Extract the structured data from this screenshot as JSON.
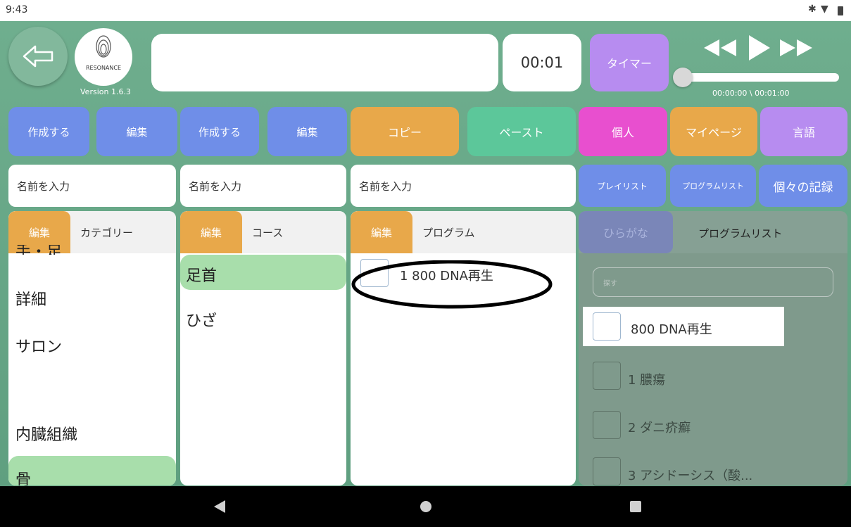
{
  "status": {
    "time": "9:43",
    "icons": [
      "bluetooth-icon",
      "wifi-icon",
      "battery-icon"
    ]
  },
  "header": {
    "logo_text": "RESONANCE",
    "version": "Version 1.6.3",
    "title_value": "",
    "counter": "00:01",
    "timer_label": "タイマー",
    "playback_time": "00:00:00 \\ 00:01:00",
    "progress": 0.0
  },
  "toolbar": {
    "cat_create": "作成する",
    "cat_edit": "編集",
    "course_create": "作成する",
    "course_edit": "編集",
    "copy": "コピー",
    "paste": "ペースト",
    "personal": "個人",
    "mypage": "マイページ",
    "language": "言語"
  },
  "inputs": {
    "category_placeholder": "名前を入力",
    "course_placeholder": "名前を入力",
    "program_placeholder": "名前を入力"
  },
  "right_tabs": {
    "playlist": "プレイリスト",
    "program_list": "プログラムリスト",
    "records": "個々の記録"
  },
  "category_panel": {
    "edit": "編集",
    "title": "カテゴリー",
    "items": [
      "手・足",
      "詳細",
      "サロン",
      "内臓組織",
      "骨"
    ]
  },
  "course_panel": {
    "edit": "編集",
    "title": "コース",
    "items": [
      "足首",
      "ひざ"
    ]
  },
  "program_panel": {
    "edit": "編集",
    "title": "プログラム",
    "items": [
      "1  800 DNA再生"
    ]
  },
  "list_panel": {
    "hiragana": "ひらがな",
    "title": "プログラムリスト",
    "search_placeholder": "探す",
    "items": [
      "800 DNA再生",
      "1 膿瘍",
      "2 ダニ疥癬",
      "3 アシドーシス（酸..."
    ]
  },
  "colors": {
    "blue": "#6f8ee8",
    "orange": "#e8a84a",
    "green": "#5cc79a",
    "magenta": "#e84fcf",
    "purple": "#b78cf0",
    "selected": "#a8deab"
  }
}
